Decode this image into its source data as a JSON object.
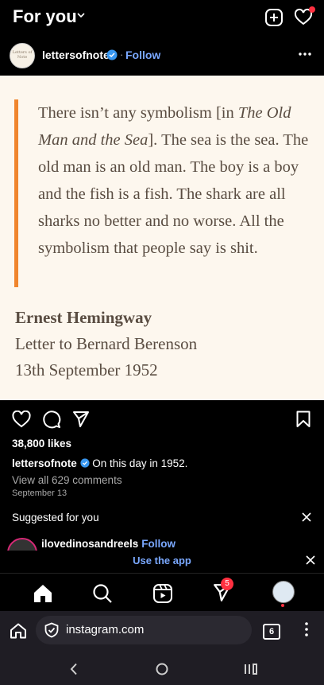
{
  "header": {
    "title": "For you"
  },
  "post": {
    "username": "lettersofnote",
    "follow_label": "Follow",
    "separator": "·",
    "avatar_text": "Letters of Note",
    "quote_html_parts": {
      "p1": "There isn’t any symbolism [in ",
      "italic": "The Old Man and the Sea",
      "p2": "]. The sea is the sea. The old man is an old man. The boy is a boy and the fish is a fish. The shark are all sharks no better and no worse. All the symbolism that people say is shit."
    },
    "author": "Ernest Hemingway",
    "source_line": "Letter to Bernard Berenson",
    "date_line": "13th September 1952",
    "likes": "38,800 likes",
    "caption_user": "lettersofnote",
    "caption_text": "On this day in 1952.",
    "comments_link": "View all 629 comments",
    "post_date": "September 13"
  },
  "suggested": {
    "title": "Suggested for you",
    "name": "ilovedinosandreels",
    "separator": "·",
    "follow_label": "Follow"
  },
  "app_banner": {
    "label": "Use the app"
  },
  "tabbar": {
    "dm_badge": "5"
  },
  "browser": {
    "url": "instagram.com",
    "tab_count": "6"
  },
  "colors": {
    "accent_blue": "#7aa8ff",
    "quote_bar": "#f0852d",
    "notification": "#ff3040",
    "image_bg": "#fdf7ee"
  }
}
